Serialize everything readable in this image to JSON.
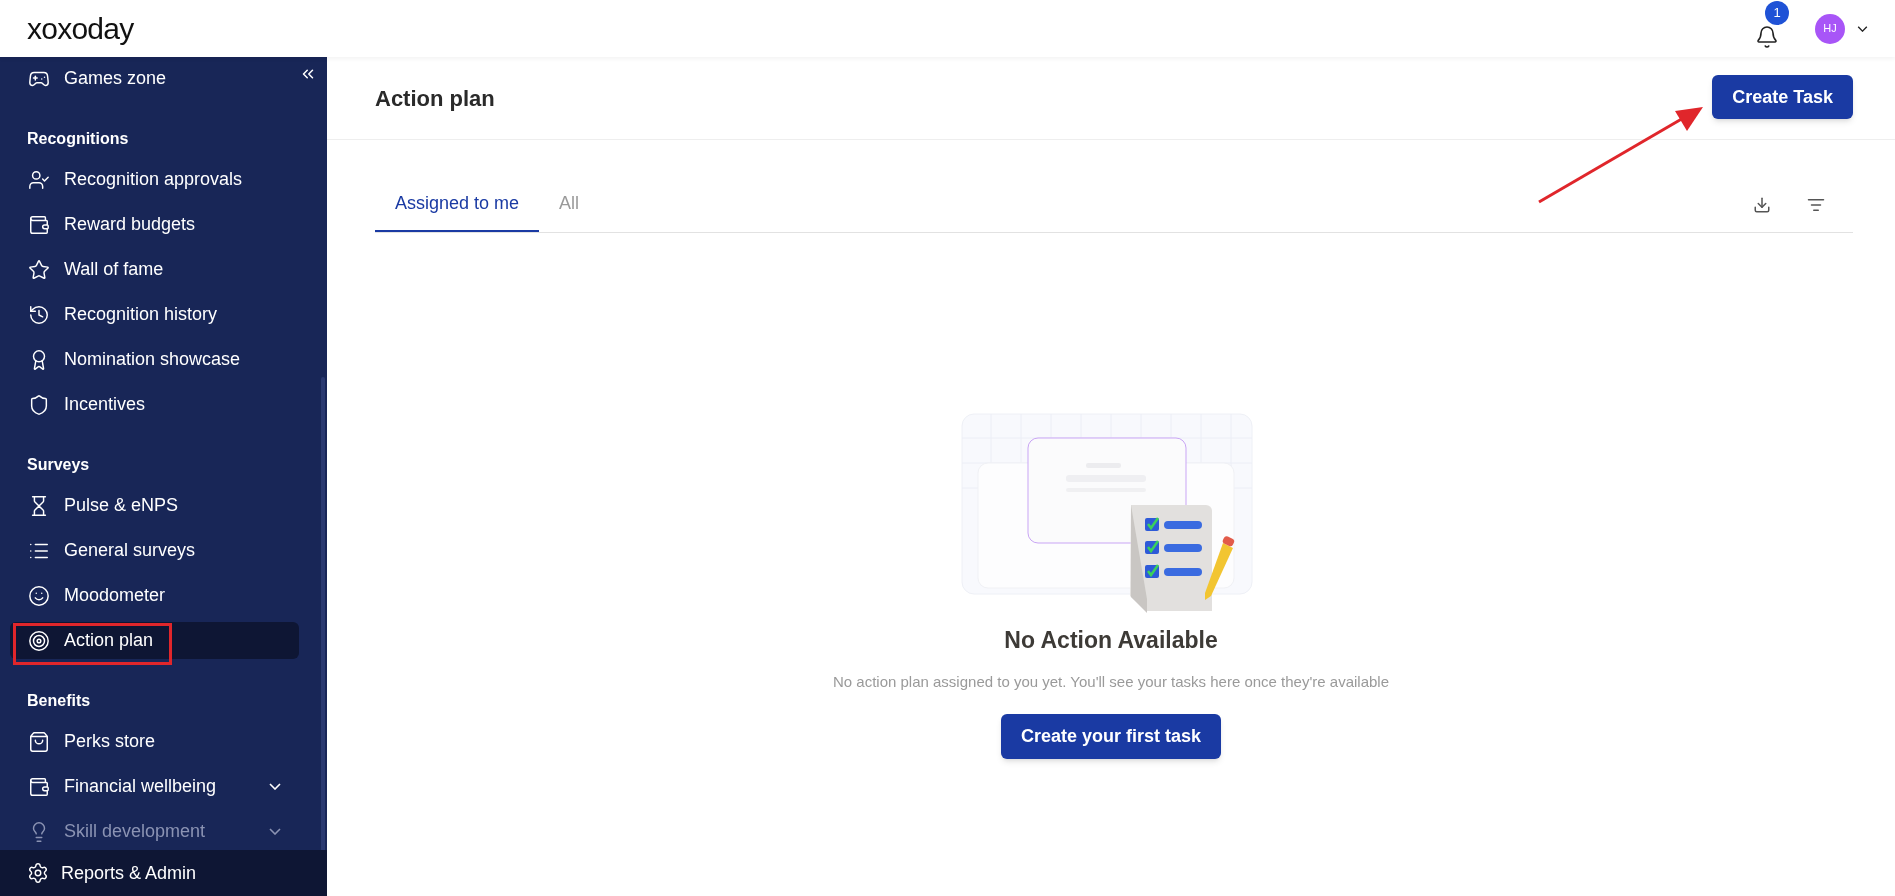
{
  "header": {
    "logo": "xoxoday",
    "notifications": {
      "count": "1"
    },
    "avatar": {
      "initials": "HJ"
    }
  },
  "sidebar": {
    "top_items": [
      {
        "label": "Games zone",
        "selected": false
      }
    ],
    "sections": [
      {
        "title": "Recognitions",
        "items": [
          {
            "label": "Recognition approvals",
            "selected": false,
            "expandable": false,
            "dimmed": false
          },
          {
            "label": "Reward budgets",
            "selected": false,
            "expandable": false,
            "dimmed": false
          },
          {
            "label": "Wall of fame",
            "selected": false,
            "expandable": false,
            "dimmed": false
          },
          {
            "label": "Recognition history",
            "selected": false,
            "expandable": false,
            "dimmed": false
          },
          {
            "label": "Nomination showcase",
            "selected": false,
            "expandable": false,
            "dimmed": false
          },
          {
            "label": "Incentives",
            "selected": false,
            "expandable": false,
            "dimmed": false
          }
        ]
      },
      {
        "title": "Surveys",
        "items": [
          {
            "label": "Pulse & eNPS",
            "selected": false,
            "expandable": false,
            "dimmed": false
          },
          {
            "label": "General surveys",
            "selected": false,
            "expandable": false,
            "dimmed": false
          },
          {
            "label": "Moodometer",
            "selected": false,
            "expandable": false,
            "dimmed": false
          },
          {
            "label": "Action plan",
            "selected": true,
            "expandable": false,
            "dimmed": false
          }
        ]
      },
      {
        "title": "Benefits",
        "items": [
          {
            "label": "Perks store",
            "selected": false,
            "expandable": false,
            "dimmed": false
          },
          {
            "label": "Financial wellbeing",
            "selected": false,
            "expandable": true,
            "dimmed": false
          },
          {
            "label": "Skill development",
            "selected": false,
            "expandable": true,
            "dimmed": true
          }
        ]
      }
    ],
    "footer": {
      "label": "Reports & Admin"
    }
  },
  "page": {
    "title": "Action plan",
    "primary_button": "Create Task",
    "tabs": [
      {
        "label": "Assigned to me",
        "selected": true
      },
      {
        "label": "All",
        "selected": false
      }
    ],
    "empty_state": {
      "heading": "No Action Available",
      "message": "No action plan assigned to you yet. You'll see your tasks here once they're available",
      "button": "Create your first task"
    }
  }
}
